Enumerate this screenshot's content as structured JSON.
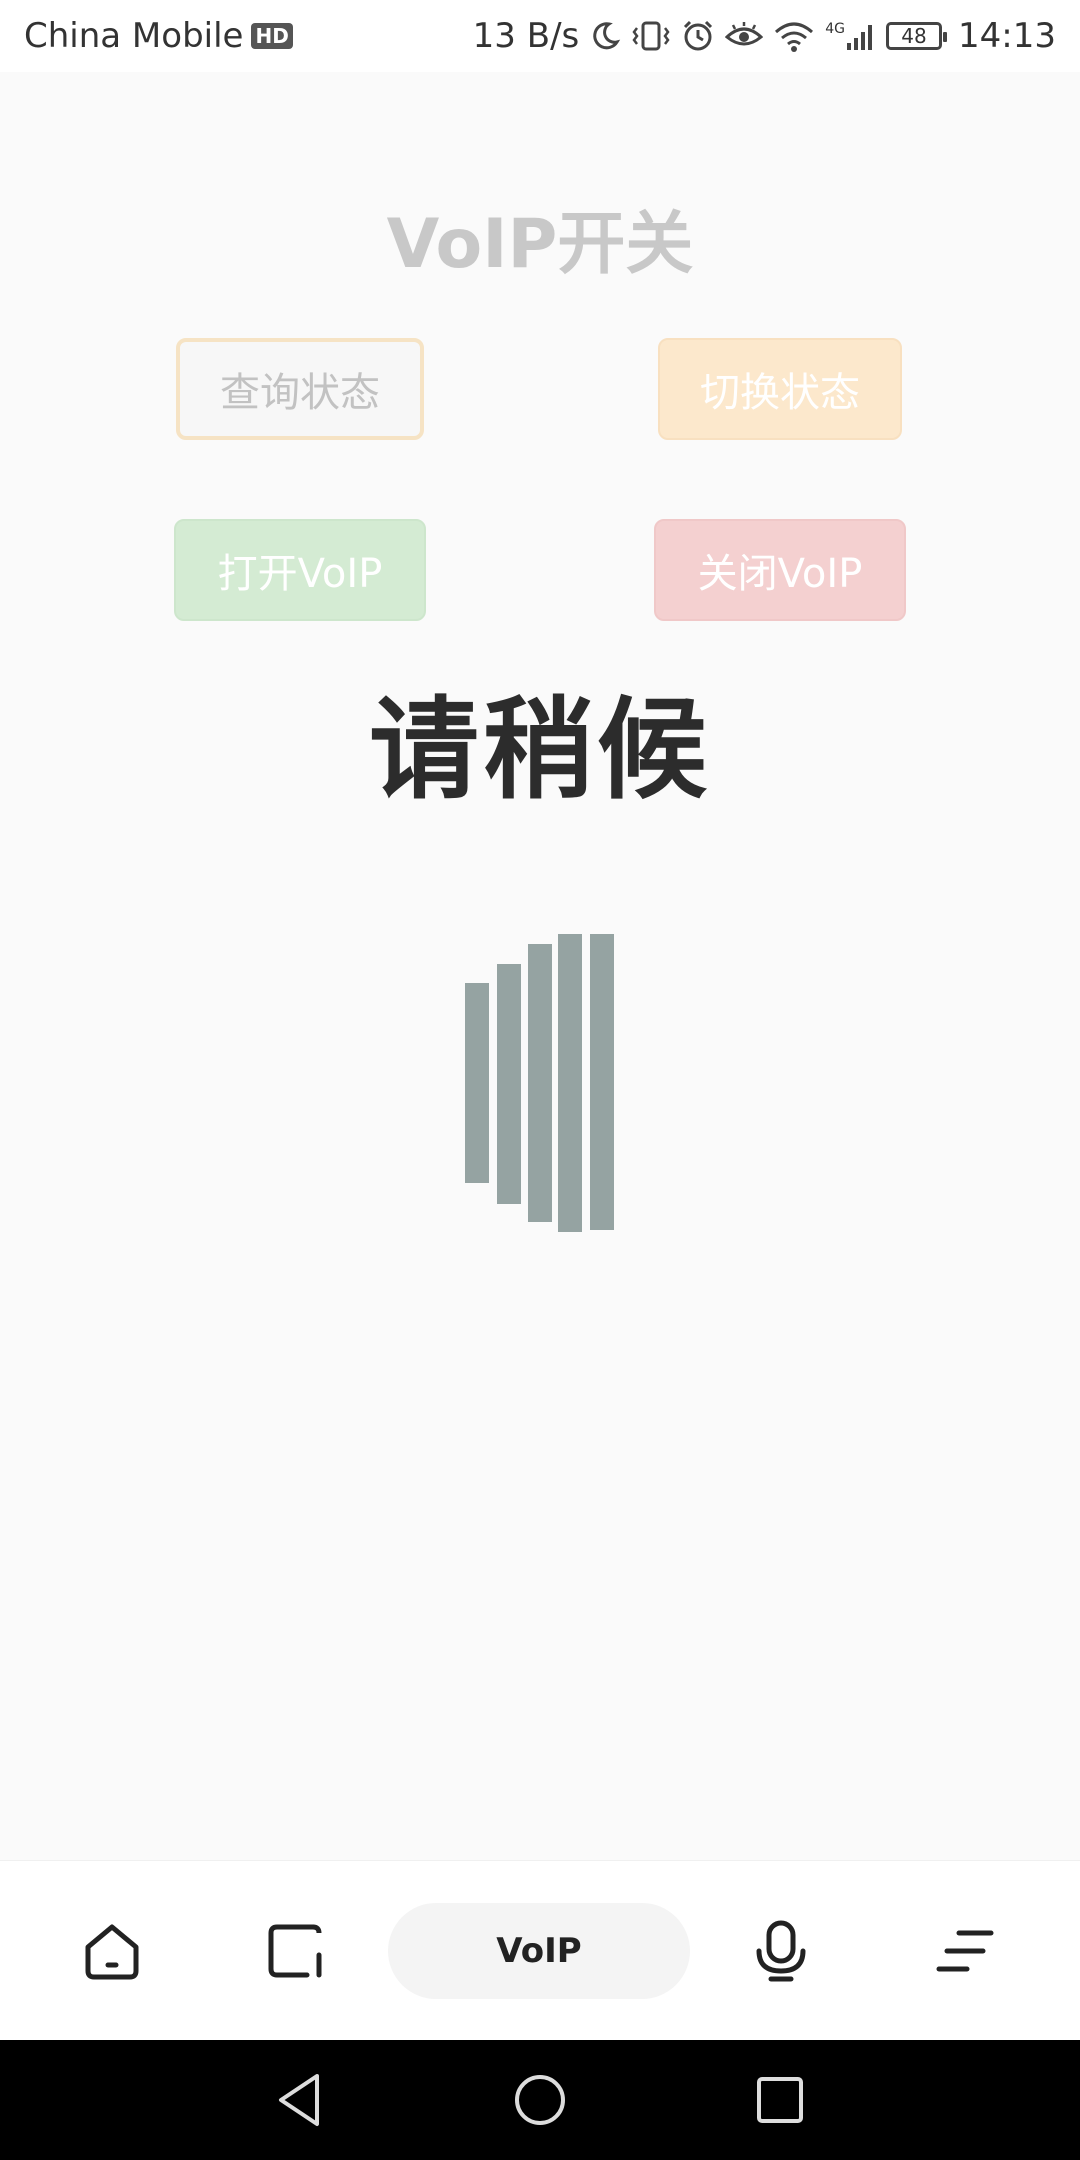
{
  "status_bar": {
    "carrier": "China Mobile",
    "hd_badge": "HD",
    "net_speed": "13 B/s",
    "network_type": "4G",
    "battery": "48",
    "time": "14:13",
    "icons": [
      "moon-icon",
      "vibrate-icon",
      "alarm-icon",
      "eye-icon",
      "wifi-icon",
      "signal-icon",
      "battery-icon"
    ]
  },
  "main": {
    "title": "VoIP开关",
    "buttons": {
      "query": "查询状态",
      "toggle": "切换状态",
      "on": "打开VoIP",
      "off": "关闭VoIP"
    },
    "wait_text": "请稍候"
  },
  "bottom_nav": {
    "voip_label": "VoIP",
    "items": [
      "home-icon",
      "screen-icon",
      "voip",
      "mic-icon",
      "menu-icon"
    ]
  },
  "system_nav": {
    "items": [
      "back-icon",
      "home-circle-icon",
      "recent-apps-icon"
    ]
  },
  "colors": {
    "title": "#c8c8c8",
    "query_border": "#f6e3c4",
    "toggle_bg": "#fce8cc",
    "on_bg": "#d4ebd3",
    "off_bg": "#f4d0d0",
    "loader_bar": "#95a3a2",
    "wait_text": "#2c2c2c"
  }
}
